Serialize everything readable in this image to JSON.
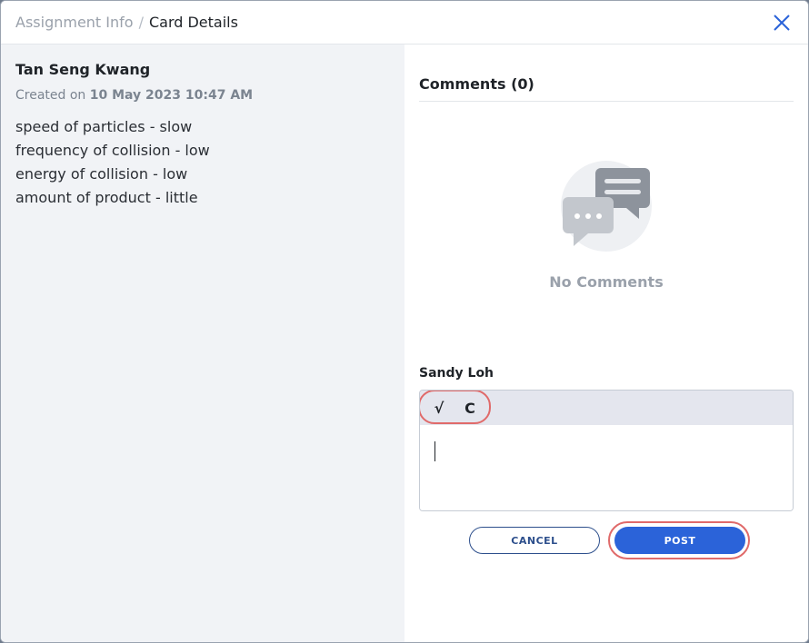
{
  "header": {
    "breadcrumb_parent": "Assignment Info",
    "breadcrumb_separator": "/",
    "breadcrumb_current": "Card Details",
    "close_icon": "close-icon"
  },
  "card": {
    "author": "Tan Seng Kwang",
    "created_prefix": "Created on",
    "created_date": "10 May 2023 10:47 AM",
    "lines": [
      "speed of particles - slow",
      "frequency of collision - low",
      "energy of collision - low",
      "amount of product - little"
    ]
  },
  "comments": {
    "title": "Comments (0)",
    "empty_icon": "chat-bubbles-icon",
    "empty_text": "No Comments"
  },
  "composer": {
    "user": "Sandy Loh",
    "toolbar": {
      "math_icon_glyph": "√",
      "chem_icon_glyph": "C"
    },
    "value": ""
  },
  "actions": {
    "cancel_label": "CANCEL",
    "post_label": "POST"
  },
  "colors": {
    "accent": "#2b63d9",
    "highlight": "#e06a6a",
    "left_pane_bg": "#f1f3f6"
  }
}
